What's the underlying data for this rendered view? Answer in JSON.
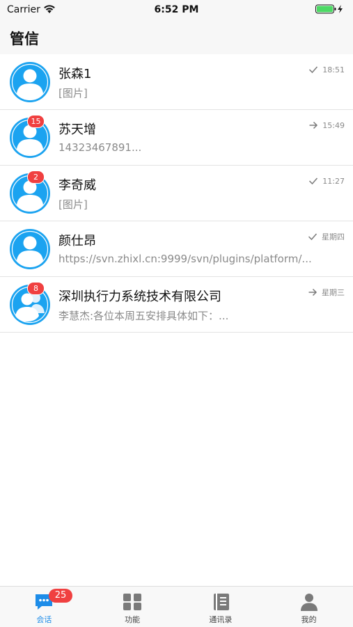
{
  "status_bar": {
    "carrier": "Carrier",
    "time": "6:52 PM"
  },
  "header": {
    "title": "管信"
  },
  "conversations": [
    {
      "name": "张森1",
      "preview": "[图片]",
      "time": "18:51",
      "status_icon": "check-icon",
      "badge": "",
      "avatar_type": "person"
    },
    {
      "name": "苏天增",
      "preview": "14323467891...",
      "time": "15:49",
      "status_icon": "arrow-right-icon",
      "badge": "15",
      "avatar_type": "person"
    },
    {
      "name": "李奇威",
      "preview": "[图片]",
      "time": "11:27",
      "status_icon": "check-icon",
      "badge": "2",
      "avatar_type": "person"
    },
    {
      "name": "颜仕昂",
      "preview": "https://svn.zhixl.cn:9999/svn/plugins/platform/...",
      "time": "星期四",
      "status_icon": "check-icon",
      "badge": "",
      "avatar_type": "person"
    },
    {
      "name": "深圳执行力系统技术有限公司",
      "preview": "李慧杰:各位本周五安排具体如下：...",
      "time": "星期三",
      "status_icon": "arrow-right-icon",
      "badge": "8",
      "avatar_type": "group"
    }
  ],
  "tab_bar": {
    "tabs": [
      {
        "label": "会话",
        "icon": "chat-icon",
        "active": true,
        "badge": "25"
      },
      {
        "label": "功能",
        "icon": "grid-icon",
        "active": false
      },
      {
        "label": "通讯录",
        "icon": "contacts-book-icon",
        "active": false
      },
      {
        "label": "我的",
        "icon": "profile-icon",
        "active": false
      }
    ]
  },
  "colors": {
    "accent": "#1d8ce8",
    "badge": "#f04040",
    "avatar": "#1ba3f0"
  }
}
